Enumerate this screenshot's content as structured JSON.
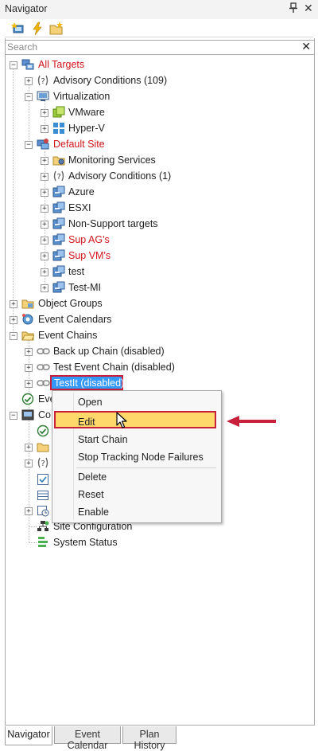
{
  "window": {
    "title": "Navigator",
    "pin_glyph": "†",
    "close_glyph": "✕"
  },
  "toolbar": {
    "buttons": [
      "add-target-icon",
      "lightning-icon",
      "folder-star-icon"
    ]
  },
  "search": {
    "placeholder": "Search",
    "value": "",
    "clear_glyph": "✕"
  },
  "tree": {
    "all_targets": "All Targets",
    "advisory_conditions": "Advisory Conditions (109)",
    "virtualization": "Virtualization",
    "vmware": "VMware",
    "hyperv": "Hyper-V",
    "default_site": "Default Site",
    "monitoring_services": "Monitoring Services",
    "advisory_conditions_site": "Advisory Conditions (1)",
    "azure": "Azure",
    "esxi": "ESXI",
    "non_support": "Non-Support targets",
    "sup_ags": "Sup AG's",
    "sup_vms": "Sup VM's",
    "test": "test",
    "test_mi": "Test-MI",
    "object_groups": "Object Groups",
    "event_calendars": "Event Calendars",
    "event_chains": "Event Chains",
    "backup_chain": "Back up Chain (disabled)",
    "test_event_chain": "Test Event Chain (disabled)",
    "testit": "TestIt (disabled)",
    "eve_partial": "Eve",
    "con_partial": "Co",
    "site_configuration": "Site Configuration",
    "system_status": "System Status"
  },
  "context_menu": {
    "open": "Open",
    "edit": "Edit",
    "start_chain": "Start Chain",
    "stop_tracking": "Stop Tracking Node Failures",
    "delete": "Delete",
    "reset": "Reset",
    "enable": "Enable"
  },
  "tabs": [
    "Navigator",
    "Event Calendar",
    "Plan History"
  ],
  "colors": {
    "red_label": "#d0161b",
    "selection": "#3399ff",
    "highlight": "#ffd86b",
    "annotation": "#c81f3a"
  }
}
